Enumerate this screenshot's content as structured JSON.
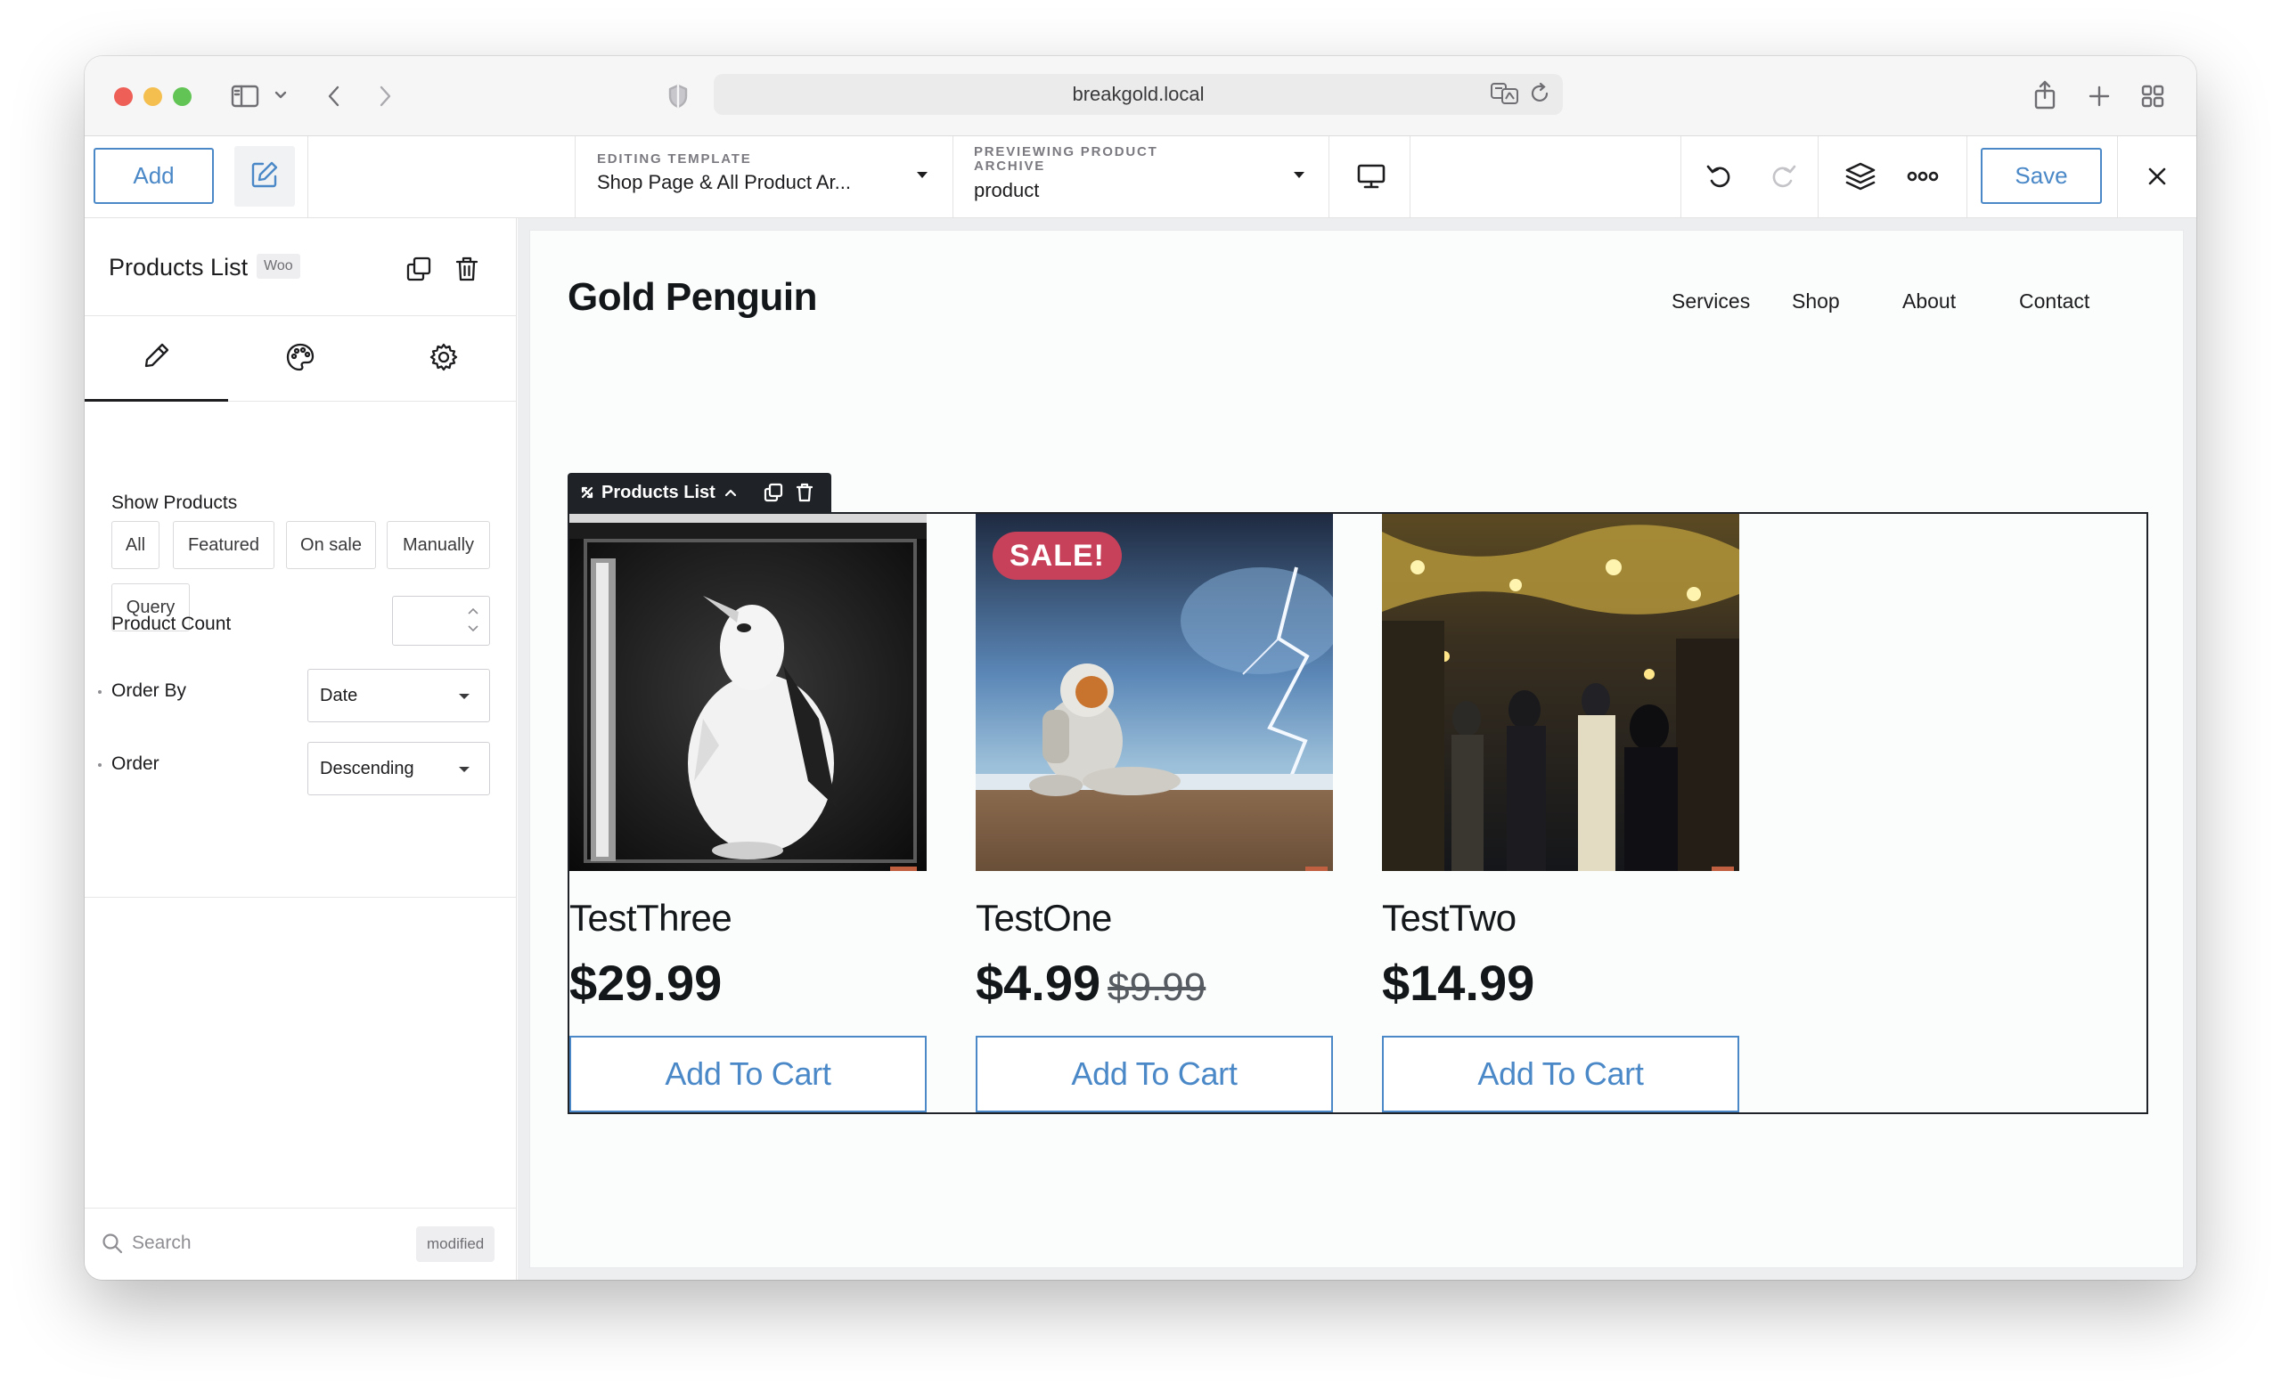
{
  "browser": {
    "url": "breakgold.local"
  },
  "toolbar": {
    "add_label": "Add",
    "editing_eyebrow": "EDITING TEMPLATE",
    "editing_value": "Shop Page & All Product Ar...",
    "previewing_eyebrow": "PREVIEWING PRODUCT ARCHIVE",
    "previewing_value": "product",
    "save_label": "Save"
  },
  "panel": {
    "title": "Products List",
    "badge": "Woo",
    "show_products_label": "Show Products",
    "show_products_options": [
      "All",
      "Featured",
      "On sale",
      "Manually",
      "Query"
    ],
    "product_count_label": "Product Count",
    "product_count_value": "",
    "order_by_label": "Order By",
    "order_by_value": "Date",
    "order_label": "Order",
    "order_value": "Descending",
    "search_placeholder": "Search",
    "modified_label": "modified"
  },
  "site": {
    "title": "Gold Penguin",
    "nav": [
      "Services",
      "Shop",
      "About",
      "Contact"
    ]
  },
  "block_label": "Products List",
  "products": [
    {
      "name": "TestThree",
      "price": "$29.99",
      "old_price": "",
      "button": "Add To Cart",
      "sale": ""
    },
    {
      "name": "TestOne",
      "price": "$4.99",
      "old_price": "$9.99",
      "button": "Add To Cart",
      "sale": "SALE!"
    },
    {
      "name": "TestTwo",
      "price": "$14.99",
      "old_price": "",
      "button": "Add To Cart",
      "sale": ""
    }
  ],
  "colors": {
    "accent": "#4a88c7",
    "sale_badge": "#c8415a",
    "dark": "#1f2328"
  }
}
